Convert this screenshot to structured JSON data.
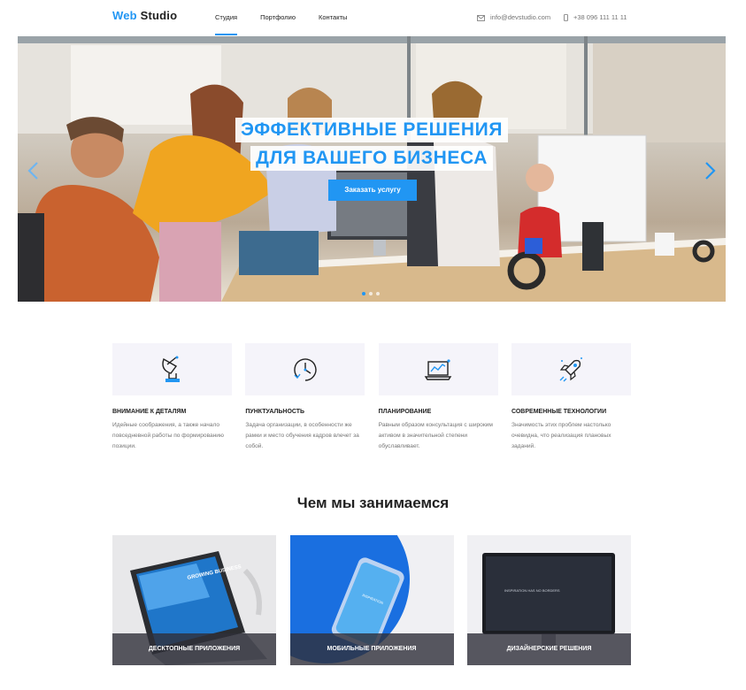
{
  "header": {
    "logo_accent": "Web",
    "logo_rest": " Studio",
    "nav": [
      {
        "label": "Студия",
        "active": true
      },
      {
        "label": "Портфолио",
        "active": false
      },
      {
        "label": "Контакты",
        "active": false
      }
    ],
    "email": "info@devstudio.com",
    "phone": "+38 096 111 11 11"
  },
  "hero": {
    "title_line1": "ЭФФЕКТИВНЫЕ РЕШЕНИЯ",
    "title_line2": "ДЛЯ ВАШЕГО БИЗНЕСА",
    "cta": "Заказать услугу",
    "slides_count": 3,
    "active_slide": 1
  },
  "features": [
    {
      "icon": "satellite-dish-icon",
      "title": "ВНИМАНИЕ К ДЕТАЛЯМ",
      "text": "Идейные соображения, а также начало повседневной работы по формированию позиции."
    },
    {
      "icon": "clock-icon",
      "title": "ПУНКТУАЛЬНОСТЬ",
      "text": "Задача организации, в особенности же рамки и место обучения кадров влечет за собой."
    },
    {
      "icon": "laptop-chart-icon",
      "title": "ПЛАНИРОВАНИЕ",
      "text": "Равным образом консультация с широким активом в значительной степени обуславливает."
    },
    {
      "icon": "rocket-icon",
      "title": "СОВРЕМЕННЫЕ ТЕХНОЛОГИИ",
      "text": "Значимость этих проблем настолько очевидна, что реализация плановых заданий."
    }
  ],
  "services": {
    "title": "Чем мы занимаемся",
    "cards": [
      {
        "label": "ДЕСКТОПНЫЕ ПРИЛОЖЕНИЯ",
        "screen_text": "GROWING BUSINESS"
      },
      {
        "label": "МОБИЛЬНЫЕ ПРИЛОЖЕНИЯ",
        "screen_text": "INSPIRATION"
      },
      {
        "label": "ДИЗАЙНЕРСКИЕ РЕШЕНИЯ",
        "screen_text": "INSPIRATION HAS NO BORDERS"
      }
    ]
  },
  "colors": {
    "accent": "#2196f3",
    "text": "#212121",
    "muted": "#757575",
    "feature_bg": "#f5f4fa"
  }
}
